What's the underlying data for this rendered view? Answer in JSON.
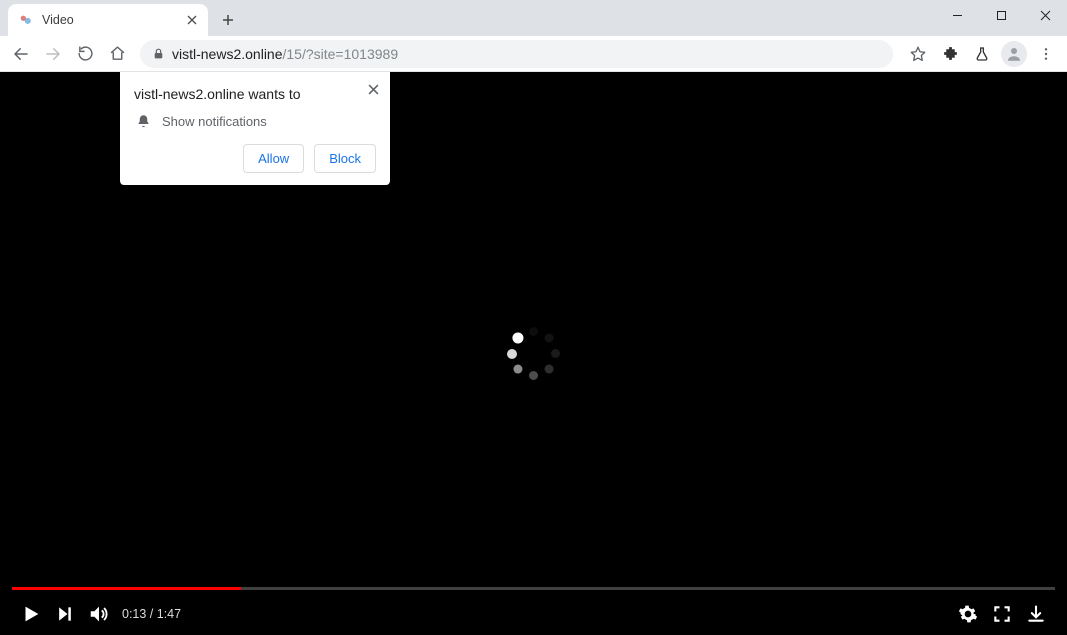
{
  "tab": {
    "title": "Video"
  },
  "url": {
    "domain": "vistl-news2.online",
    "path": "/15/?site=1013989"
  },
  "perm": {
    "title": "vistl-news2.online wants to",
    "item": "Show notifications",
    "allow": "Allow",
    "block": "Block"
  },
  "video": {
    "time": "0:13 / 1:47",
    "progress_pct": 22
  }
}
